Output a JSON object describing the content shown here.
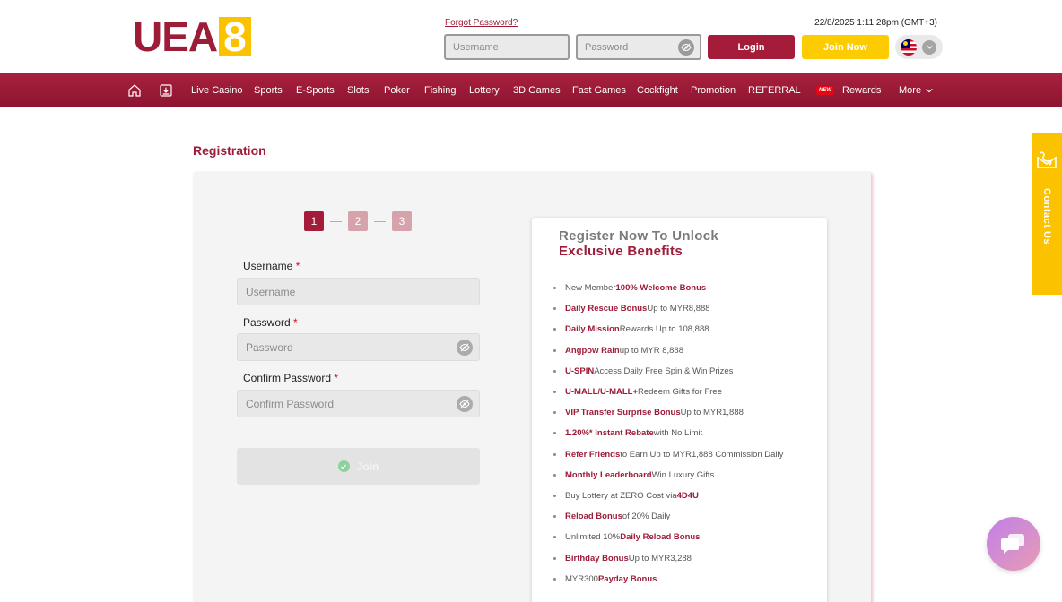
{
  "header": {
    "logo": "UEA",
    "logo_eight": "8",
    "forgot_password": "Forgot Password?",
    "datetime": "22/8/2025 1:11:28pm (GMT+3)",
    "username_placeholder": "Username",
    "password_placeholder": "Password",
    "login_label": "Login",
    "join_label": "Join Now",
    "language": "Malaysia"
  },
  "nav": {
    "items": [
      "Live Casino",
      "Sports",
      "E-Sports",
      "Slots",
      "Poker",
      "Fishing",
      "Lottery",
      "3D Games",
      "Fast Games",
      "Cockfight",
      "Promotion",
      "REFERRAL",
      "Rewards",
      "More"
    ],
    "new_badge": "NEW"
  },
  "registration": {
    "title": "Registration",
    "steps": [
      "1",
      "2",
      "3"
    ],
    "username_label": "Username",
    "username_placeholder": "Username",
    "password_label": "Password",
    "password_placeholder": "Password",
    "confirm_label": "Confirm Password",
    "confirm_placeholder": "Confirm Password",
    "required_mark": "*",
    "submit_label": "Join"
  },
  "benefits": {
    "title_line1": "Register Now To Unlock",
    "title_line2": "Exclusive Benefits",
    "items": [
      {
        "pre": "New Member ",
        "bold": "100% Welcome Bonus",
        "post": ""
      },
      {
        "pre": "",
        "bold": "Daily Rescue Bonus",
        "post": " Up to MYR8,888"
      },
      {
        "pre": "",
        "bold": "Daily Mission",
        "post": " Rewards Up to 108,888"
      },
      {
        "pre": "",
        "bold": "Angpow Rain",
        "post": " up to MYR 8,888"
      },
      {
        "pre": "",
        "bold": "U-SPIN",
        "post": " Access Daily Free Spin & Win Prizes"
      },
      {
        "pre": "",
        "bold": "U-MALL/U-MALL+",
        "post": " Redeem Gifts for Free"
      },
      {
        "pre": "",
        "bold": "VIP Transfer Surprise Bonus",
        "post": " Up to MYR1,888"
      },
      {
        "pre": "",
        "bold": "1.20%* Instant Rebate",
        "post": " with No Limit"
      },
      {
        "pre": "",
        "bold": "Refer Friends",
        "post": " to Earn Up to MYR1,888 Commission Daily"
      },
      {
        "pre": "",
        "bold": "Monthly Leaderboard",
        "post": " Win Luxury Gifts"
      },
      {
        "pre": "Buy Lottery at ZERO Cost via ",
        "bold": "4D4U",
        "post": ""
      },
      {
        "pre": "",
        "bold": "Reload Bonus",
        "post": " of 20% Daily"
      },
      {
        "pre": "Unlimited 10% ",
        "bold": "Daily Reload Bonus",
        "post": ""
      },
      {
        "pre": "",
        "bold": "Birthday Bonus",
        "post": " Up to MYR3,288"
      },
      {
        "pre": "MYR300 ",
        "bold": "Payday Bonus",
        "post": ""
      }
    ]
  },
  "contact": {
    "label": "Contact Us"
  },
  "colors": {
    "brand": "#9d1c38",
    "accent": "#fbc200"
  }
}
